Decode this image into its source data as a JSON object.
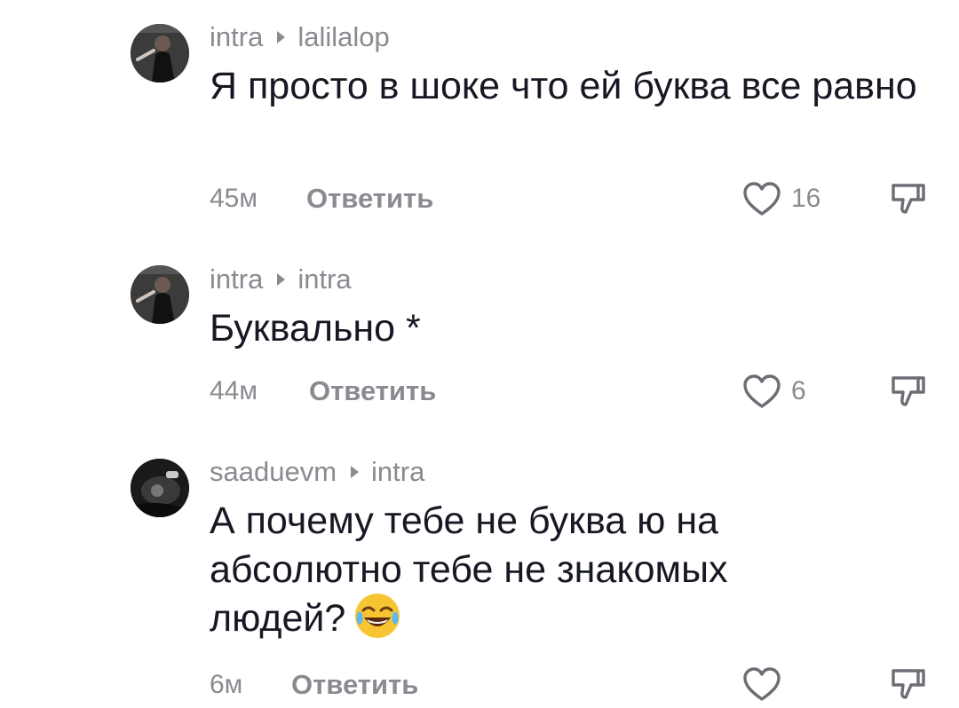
{
  "comments": [
    {
      "author": "intra",
      "reply_to": "lalilalop",
      "text": "Я просто в шоке что ей буква все равно",
      "time": "45м",
      "reply_label": "Ответить",
      "likes": "16"
    },
    {
      "author": "intra",
      "reply_to": "intra",
      "text": "Буквально *",
      "time": "44м",
      "reply_label": "Ответить",
      "likes": "6"
    },
    {
      "author": "saaduevm",
      "reply_to": "intra",
      "text": "А почему тебе не буква ю на абсолютно тебе не знакомых людей?",
      "emoji": "tears-of-joy-emoji",
      "time": "6м",
      "reply_label": "Ответить",
      "likes": ""
    }
  ],
  "icons": {
    "like": "heart-outline-icon",
    "dislike": "thumbs-down-icon",
    "reply_separator": "triangle-right-icon"
  },
  "colors": {
    "text": "#161823",
    "muted": "#8a8b91",
    "background": "#ffffff"
  }
}
